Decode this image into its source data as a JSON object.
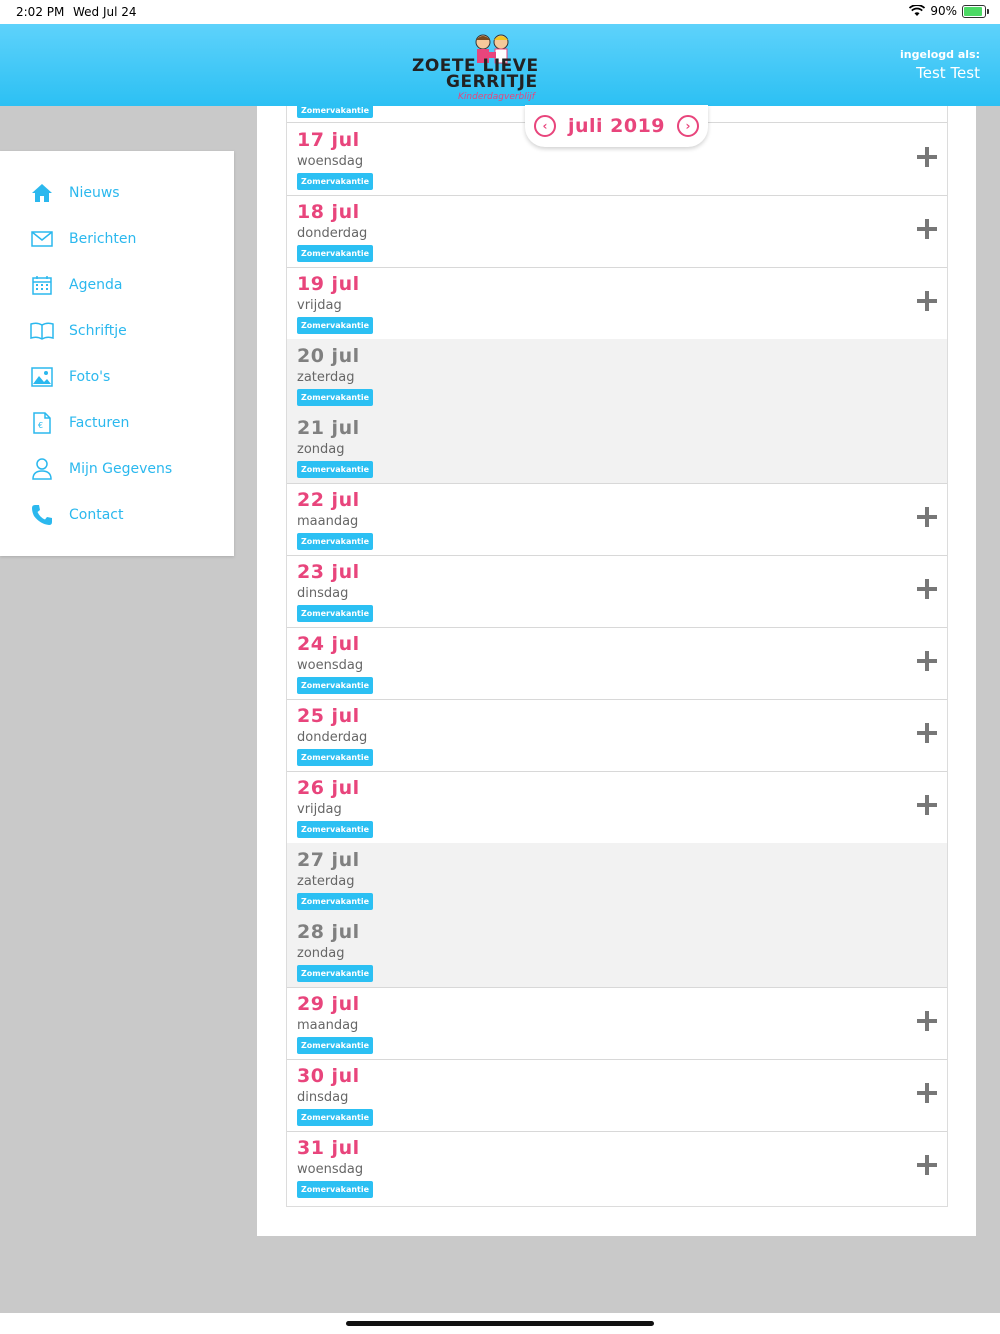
{
  "status": {
    "time": "2:02 PM",
    "date": "Wed Jul 24",
    "battery": "90%"
  },
  "header": {
    "logo": {
      "line1": "ZOETE  LIEVE",
      "line2": "GERRITJE",
      "tagline": "Kinderdagverblijf"
    },
    "login_label": "ingelogd als:",
    "user_name": "Test Test"
  },
  "sidebar": {
    "items": [
      {
        "label": "Nieuws",
        "icon": "home-icon"
      },
      {
        "label": "Berichten",
        "icon": "envelope-icon"
      },
      {
        "label": "Agenda",
        "icon": "calendar-icon"
      },
      {
        "label": "Schriftje",
        "icon": "book-icon"
      },
      {
        "label": "Foto's",
        "icon": "photo-icon"
      },
      {
        "label": "Facturen",
        "icon": "invoice-icon"
      },
      {
        "label": "Mijn Gegevens",
        "icon": "user-icon"
      },
      {
        "label": "Contact",
        "icon": "phone-icon"
      }
    ]
  },
  "calendar": {
    "month_label": "juli 2019",
    "top_badge": "Zomervakantie",
    "days": [
      {
        "date": "17 jul",
        "day": "woensdag",
        "badge": "Zomervakantie",
        "weekend": false
      },
      {
        "date": "18 jul",
        "day": "donderdag",
        "badge": "Zomervakantie",
        "weekend": false
      },
      {
        "date": "19 jul",
        "day": "vrijdag",
        "badge": "Zomervakantie",
        "weekend": false
      },
      {
        "date": "20 jul",
        "day": "zaterdag",
        "badge": "Zomervakantie",
        "weekend": true
      },
      {
        "date": "21 jul",
        "day": "zondag",
        "badge": "Zomervakantie",
        "weekend": true
      },
      {
        "date": "22 jul",
        "day": "maandag",
        "badge": "Zomervakantie",
        "weekend": false
      },
      {
        "date": "23 jul",
        "day": "dinsdag",
        "badge": "Zomervakantie",
        "weekend": false
      },
      {
        "date": "24 jul",
        "day": "woensdag",
        "badge": "Zomervakantie",
        "weekend": false
      },
      {
        "date": "25 jul",
        "day": "donderdag",
        "badge": "Zomervakantie",
        "weekend": false
      },
      {
        "date": "26 jul",
        "day": "vrijdag",
        "badge": "Zomervakantie",
        "weekend": false
      },
      {
        "date": "27 jul",
        "day": "zaterdag",
        "badge": "Zomervakantie",
        "weekend": true
      },
      {
        "date": "28 jul",
        "day": "zondag",
        "badge": "Zomervakantie",
        "weekend": true
      },
      {
        "date": "29 jul",
        "day": "maandag",
        "badge": "Zomervakantie",
        "weekend": false
      },
      {
        "date": "30 jul",
        "day": "dinsdag",
        "badge": "Zomervakantie",
        "weekend": false
      },
      {
        "date": "31 jul",
        "day": "woensdag",
        "badge": "Zomervakantie",
        "weekend": false
      }
    ]
  },
  "colors": {
    "accent": "#2cc0f3",
    "pink": "#e8457c",
    "weekend_text": "#808080"
  }
}
